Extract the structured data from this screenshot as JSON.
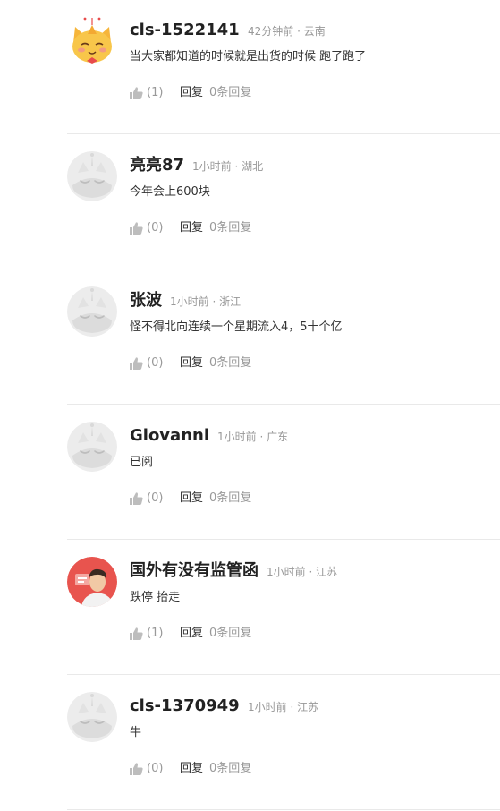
{
  "comments": [
    {
      "username": "cls-1522141",
      "time": "42分钟前",
      "location": "云南",
      "content": "当大家都知道的时候就是出货的时候 跑了跑了",
      "likes": "(1)",
      "reply_label": "回复",
      "reply_count": "0条回复",
      "avatar": "cat-avatar"
    },
    {
      "username": "亮亮87",
      "time": "1小时前",
      "location": "湖北",
      "content": "今年会上600块",
      "likes": "(0)",
      "reply_label": "回复",
      "reply_count": "0条回复",
      "avatar": "default-avatar"
    },
    {
      "username": "张波",
      "time": "1小时前",
      "location": "浙江",
      "content": "怪不得北向连续一个星期流入4，5十个亿",
      "likes": "(0)",
      "reply_label": "回复",
      "reply_count": "0条回复",
      "avatar": "default-avatar"
    },
    {
      "username": "Giovanni",
      "time": "1小时前",
      "location": "广东",
      "content": "已阅",
      "likes": "(0)",
      "reply_label": "回复",
      "reply_count": "0条回复",
      "avatar": "default-avatar"
    },
    {
      "username": "国外有没有监管函",
      "time": "1小时前",
      "location": "江苏",
      "content": "跌停 抬走",
      "likes": "(1)",
      "reply_label": "回复",
      "reply_count": "0条回复",
      "avatar": "photo-avatar"
    },
    {
      "username": "cls-1370949",
      "time": "1小时前",
      "location": "江苏",
      "content": "牛",
      "likes": "(0)",
      "reply_label": "回复",
      "reply_count": "0条回复",
      "avatar": "default-avatar"
    }
  ],
  "meta_separator": " · "
}
